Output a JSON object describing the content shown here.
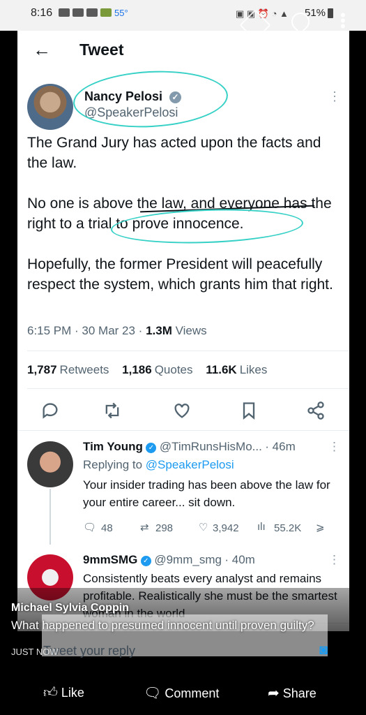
{
  "status_bar": {
    "time": "8:16",
    "temperature": "55°",
    "battery": "51%"
  },
  "header": {
    "title": "Tweet"
  },
  "tweet": {
    "author_name": "Nancy Pelosi",
    "author_handle": "@SpeakerPelosi",
    "text": "The Grand Jury has acted upon the facts and the law.\n\nNo one is above the law, and everyone has the right to a trial to prove innocence.\n\nHopefully, the former President will peacefully respect the system, which grants him that right.",
    "time": "6:15 PM · 30 Mar 23 · ",
    "views_count": "1.3M",
    "views_label": " Views",
    "retweets_count": "1,787",
    "retweets_label": "Retweets",
    "quotes_count": "1,186",
    "quotes_label": "Quotes",
    "likes_count": "11.6K",
    "likes_label": "Likes"
  },
  "replies": [
    {
      "name": "Tim Young",
      "handle": "@TimRunsHisMo...",
      "time": "· 46m",
      "replying_prefix": "Replying to ",
      "replying_to": "@SpeakerPelosi",
      "text": "Your insider trading has been above the law for your entire career... sit down.",
      "reply_count": "48",
      "retweet_count": "298",
      "like_count": "3,942",
      "view_count": "55.2K"
    },
    {
      "name": "9mmSMG",
      "handle": "@9mm_smg",
      "time": "· 40m",
      "text": "Consistently beats every analyst and remains profitable. Realistically she must be the smartest woman in the world"
    }
  ],
  "reply_input": {
    "placeholder": "Tweet your reply"
  },
  "facebook": {
    "author": "Michael Sylvia Coppin",
    "question": "What happened to presumed innocent until proven guilty?",
    "time": "JUST NOW",
    "like_label": "Like",
    "comment_label": "Comment",
    "share_label": "Share"
  },
  "colors": {
    "accent": "#1d9bf0",
    "annotation": "#35d0c6",
    "verified": "#829aab"
  }
}
